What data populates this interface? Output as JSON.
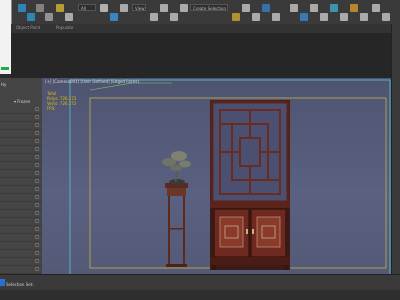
{
  "toolbar": {
    "filter_value": "All",
    "view_value": "View",
    "workspace_value": "Create Selection Se",
    "icons": [
      "undo-icon",
      "redo-icon",
      "link-icon",
      "unlink-icon",
      "bind-icon",
      "select-filter-icon",
      "select-icon",
      "select-by-name-icon",
      "rect-select-icon",
      "window-crossing-icon",
      "move-icon",
      "rotate-icon",
      "scale-icon",
      "reference-coord-icon",
      "pivot-icon",
      "snap-icon",
      "angle-snap-icon",
      "percent-snap-icon",
      "spinner-snap-icon",
      "named-selection-icon",
      "mirror-icon",
      "align-icon",
      "layer-icon",
      "graphite-icon",
      "curve-editor-icon",
      "schematic-icon",
      "material-editor-icon",
      "render-setup-icon",
      "render-frame-icon",
      "render-icon"
    ]
  },
  "ribbon": {
    "tab1": "Object Paint",
    "tab2": "Populate"
  },
  "left_panel": {
    "label": "Hy",
    "frozen": "▾ Frozen"
  },
  "viewport": {
    "label": "[+] [Camera001] [User Defined] [Edged Faces]",
    "stats": [
      "Total",
      "Polys: 726,172",
      "Verts: 726,172",
      "FPS:"
    ],
    "colors": {
      "background_top": "#4e5470",
      "background_bottom": "#535874",
      "safe_frame": "#c8b048",
      "frame_cyan": "#4ec8d8"
    }
  },
  "status": {
    "selection": "Selection Set:"
  }
}
